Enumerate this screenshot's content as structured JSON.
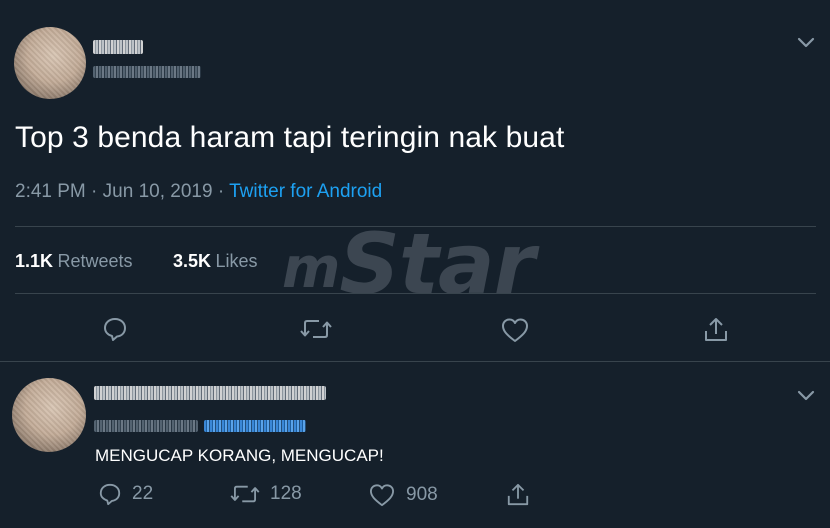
{
  "main_tweet": {
    "text": "Top 3 benda haram tapi teringin nak buat",
    "time": "2:41 PM",
    "sep1": "·",
    "date": "Jun 10, 2019",
    "sep2": "·",
    "source": "Twitter for Android",
    "retweets_count": "1.1K",
    "retweets_label": "Retweets",
    "likes_count": "3.5K",
    "likes_label": "Likes"
  },
  "reply": {
    "text": "MENGUCAP KORANG, MENGUCAP!",
    "reply_count": "22",
    "retweet_count": "128",
    "like_count": "908"
  },
  "watermark": {
    "prefix": "m",
    "text": "Star"
  },
  "colors": {
    "background": "#15202b",
    "divider": "#38444d",
    "muted": "#8899a6",
    "link": "#1da1f2"
  },
  "icons": {
    "more": "chevron-down-icon",
    "reply": "speech-bubble-icon",
    "retweet": "retweet-arrows-icon",
    "like": "heart-icon",
    "share": "share-upload-icon"
  }
}
